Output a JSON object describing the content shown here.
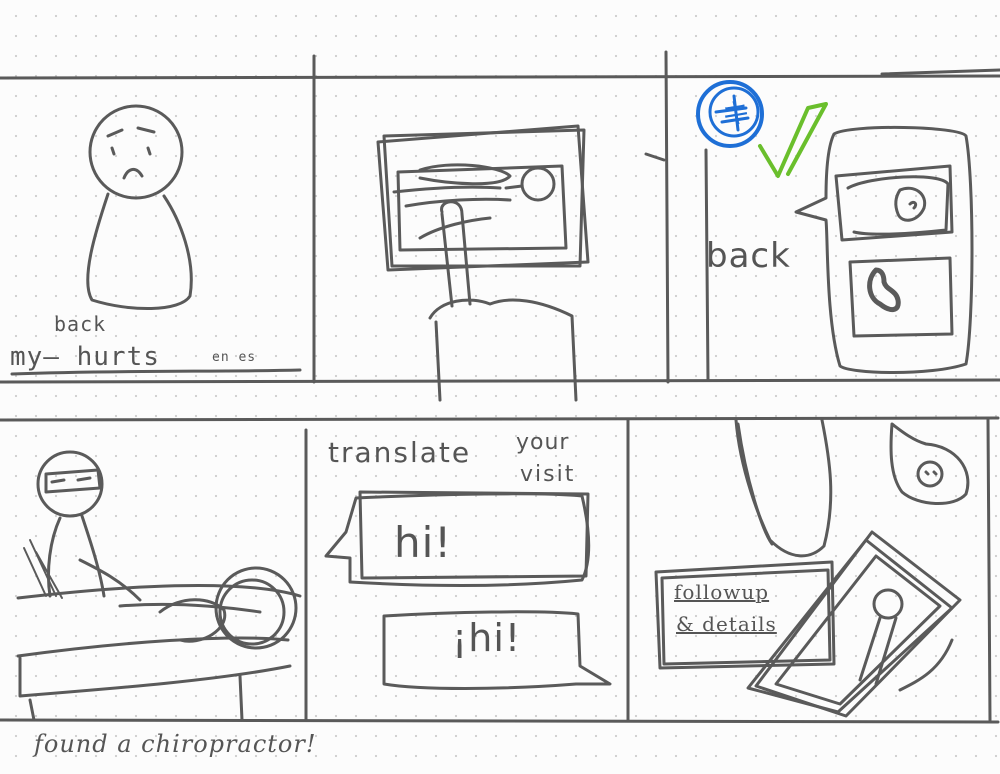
{
  "panel1": {
    "caption_my": "my—",
    "caption_hurts": "hurts",
    "caption_insert": "back",
    "caption_small": "en es"
  },
  "panel3": {
    "label": "back",
    "badge_glyph": "キ"
  },
  "panel5": {
    "title_line1": "translate",
    "title_line2a": "your",
    "title_line2b": "visit",
    "bubble_top": "hi!",
    "bubble_bottom": "¡hi!"
  },
  "panel6": {
    "line1": "followup",
    "line2": "& details"
  },
  "footer": {
    "caption": "found a chiropractor!"
  },
  "colors": {
    "stroke": "#5a5a5a",
    "blue": "#1e6fd6",
    "green": "#6abf2c"
  }
}
